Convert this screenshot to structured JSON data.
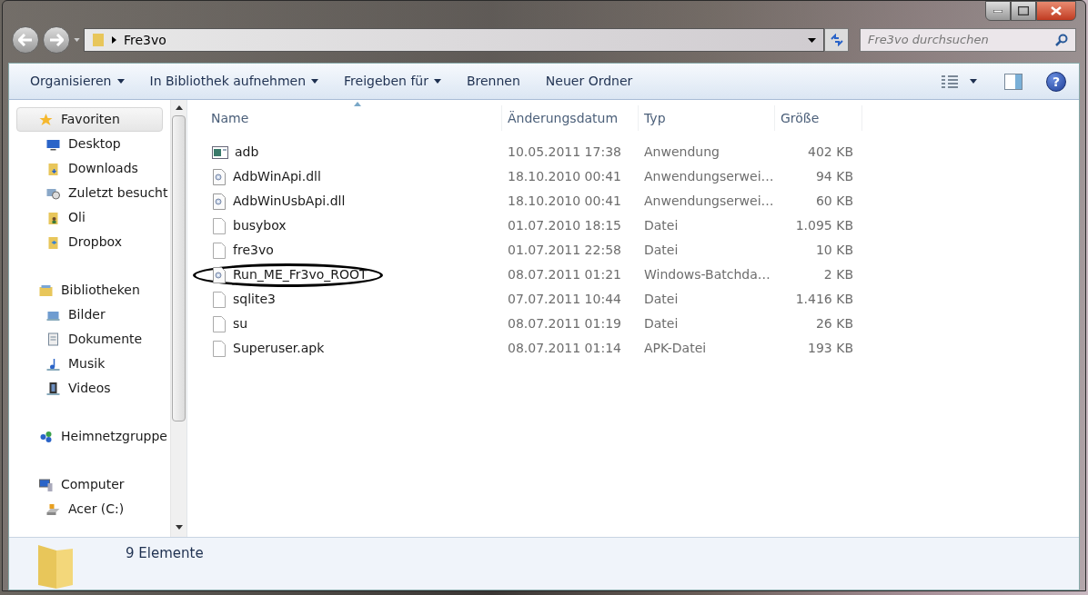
{
  "address_bar": {
    "path": "Fre3vo"
  },
  "search": {
    "placeholder": "Fre3vo durchsuchen"
  },
  "toolbar": {
    "buttons": [
      {
        "label": "Organisieren",
        "dropdown": true
      },
      {
        "label": "In Bibliothek aufnehmen",
        "dropdown": true
      },
      {
        "label": "Freigeben für",
        "dropdown": true
      },
      {
        "label": "Brennen",
        "dropdown": false
      },
      {
        "label": "Neuer Ordner",
        "dropdown": false
      }
    ],
    "help_label": "?"
  },
  "sidebar": {
    "groups": [
      {
        "label": "Favoriten",
        "kind": "star",
        "selected": true,
        "children": [
          {
            "label": "Desktop",
            "kind": "desktop",
            "selected": false
          },
          {
            "label": "Downloads",
            "kind": "downloads",
            "selected": false
          },
          {
            "label": "Zuletzt besucht",
            "kind": "recent",
            "selected": false
          },
          {
            "label": "Oli",
            "kind": "user",
            "selected": false
          },
          {
            "label": "Dropbox",
            "kind": "dropbox",
            "selected": false
          }
        ]
      },
      {
        "label": "Bibliotheken",
        "kind": "library",
        "selected": false,
        "children": [
          {
            "label": "Bilder",
            "kind": "pictures",
            "selected": false
          },
          {
            "label": "Dokumente",
            "kind": "documents",
            "selected": false
          },
          {
            "label": "Musik",
            "kind": "music",
            "selected": false
          },
          {
            "label": "Videos",
            "kind": "videos",
            "selected": false
          }
        ]
      },
      {
        "label": "Heimnetzgruppe",
        "kind": "network",
        "selected": false
      },
      {
        "label": "Computer",
        "kind": "computer",
        "selected": false,
        "children": [
          {
            "label": "Acer (C:)",
            "kind": "drive",
            "selected": false
          }
        ]
      }
    ]
  },
  "table": {
    "columns": [
      {
        "label": "Name",
        "sorted": true
      },
      {
        "label": "Änderungsdatum",
        "sorted": false
      },
      {
        "label": "Typ",
        "sorted": false
      },
      {
        "label": "Größe",
        "sorted": false
      }
    ],
    "rows": [
      {
        "name": "adb",
        "kind": "app",
        "date": "10.05.2011 17:38",
        "type": "Anwendung",
        "size": "402 KB",
        "circled": false
      },
      {
        "name": "AdbWinApi.dll",
        "kind": "dll",
        "date": "18.10.2010 00:41",
        "type": "Anwendungserwei…",
        "size": "94 KB",
        "circled": false
      },
      {
        "name": "AdbWinUsbApi.dll",
        "kind": "dll",
        "date": "18.10.2010 00:41",
        "type": "Anwendungserwei…",
        "size": "60 KB",
        "circled": false
      },
      {
        "name": "busybox",
        "kind": "file",
        "date": "01.07.2010 18:15",
        "type": "Datei",
        "size": "1.095 KB",
        "circled": false
      },
      {
        "name": "fre3vo",
        "kind": "file",
        "date": "01.07.2011 22:58",
        "type": "Datei",
        "size": "10 KB",
        "circled": false
      },
      {
        "name": "Run_ME_Fr3vo_ROOT",
        "kind": "batch",
        "date": "08.07.2011 01:21",
        "type": "Windows-Batchda…",
        "size": "2 KB",
        "circled": true
      },
      {
        "name": "sqlite3",
        "kind": "file",
        "date": "07.07.2011 10:44",
        "type": "Datei",
        "size": "1.416 KB",
        "circled": false
      },
      {
        "name": "su",
        "kind": "file",
        "date": "08.07.2011 01:19",
        "type": "Datei",
        "size": "26 KB",
        "circled": false
      },
      {
        "name": "Superuser.apk",
        "kind": "file",
        "date": "08.07.2011 01:14",
        "type": "APK-Datei",
        "size": "193 KB",
        "circled": false
      }
    ]
  },
  "status_bar": {
    "text": "9 Elemente"
  }
}
